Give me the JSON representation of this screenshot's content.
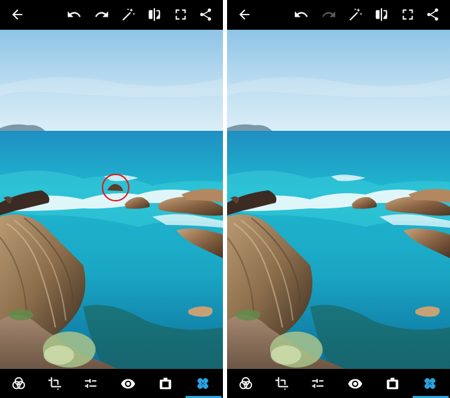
{
  "colors": {
    "bar_bg": "#000000",
    "icon": "#ffffff",
    "icon_disabled": "#5a5a5a",
    "accent": "#2aa5e0",
    "highlight_circle": "#d91e1e",
    "divider": "#ffffff"
  },
  "panels": [
    {
      "id": "before",
      "redo_enabled": true,
      "shows_selection_circle": true
    },
    {
      "id": "after",
      "redo_enabled": false,
      "shows_selection_circle": false
    }
  ],
  "top_toolbar_icons": [
    "back-arrow-icon",
    "undo-icon",
    "redo-icon",
    "magic-wand-icon",
    "compare-icon",
    "fullscreen-icon",
    "share-icon"
  ],
  "bottom_toolbar_icons": [
    "looks-icon",
    "crop-icon",
    "adjust-sliders-icon",
    "eye-icon",
    "frame-icon",
    "healing-icon"
  ],
  "active_tool": "healing-icon"
}
